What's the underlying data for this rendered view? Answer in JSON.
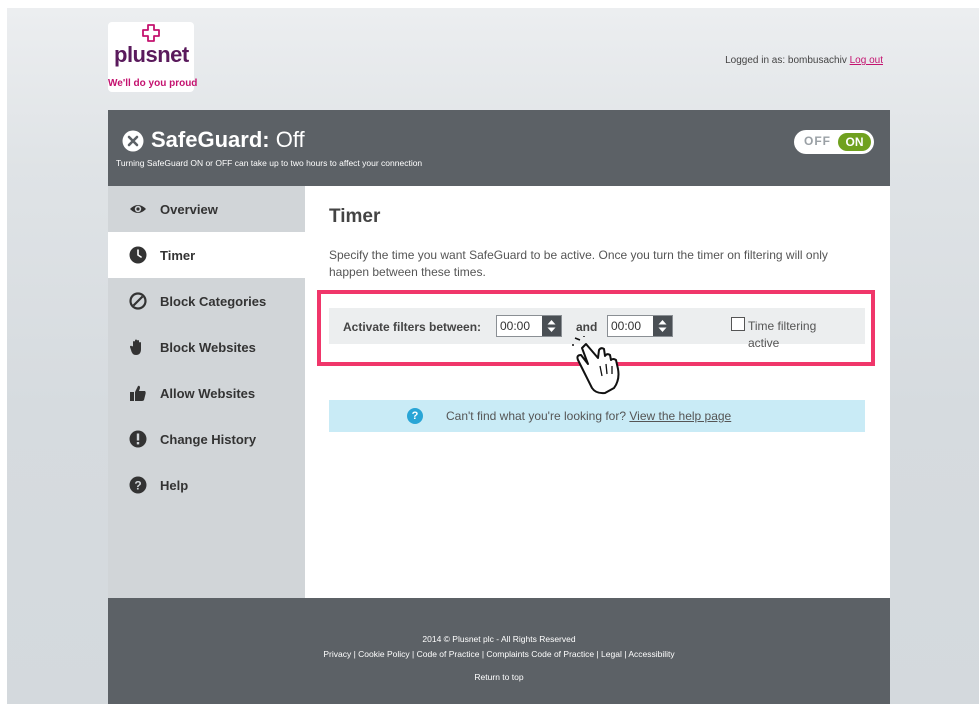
{
  "brand": {
    "name": "plusnet",
    "tagline": "We'll do you proud"
  },
  "header": {
    "logged_in_prefix": "Logged in as: bombusachiv",
    "logout_label": "Log out"
  },
  "banner": {
    "title_prefix": "SafeGuard:",
    "title_state": "Off",
    "subtitle": "Turning SafeGuard ON or OFF can take up to two hours to affect your connection",
    "toggle_off_label": "OFF",
    "toggle_on_label": "ON"
  },
  "sidebar": {
    "items": [
      {
        "label": "Overview",
        "icon": "eye-icon"
      },
      {
        "label": "Timer",
        "icon": "clock-icon",
        "active": true
      },
      {
        "label": "Block Categories",
        "icon": "prohibited-icon"
      },
      {
        "label": "Block Websites",
        "icon": "hand-stop-icon"
      },
      {
        "label": "Allow Websites",
        "icon": "thumbs-up-icon"
      },
      {
        "label": "Change History",
        "icon": "exclamation-icon"
      },
      {
        "label": "Help",
        "icon": "question-icon"
      }
    ]
  },
  "main": {
    "title": "Timer",
    "description": "Specify the time you want SafeGuard to be active. Once you turn the timer on filtering will only happen between these times.",
    "filter_label": "Activate filters between:",
    "start_time": "00:00",
    "and_label": "and",
    "end_time": "00:00",
    "checkbox_label": "Time filtering active",
    "checkbox_checked": false
  },
  "help_bar": {
    "icon_glyph": "?",
    "text": "Can't find what you're looking for?",
    "link": "View the help page"
  },
  "footer": {
    "copyright": "2014 © Plusnet plc - All Rights Reserved",
    "links": [
      "Privacy",
      "Cookie Policy",
      "Code of Practice",
      "Complaints Code of Practice",
      "Legal",
      "Accessibility"
    ],
    "return_to_top": "Return to top"
  },
  "colors": {
    "brand_purple": "#5a1a5c",
    "brand_pink": "#c4126f",
    "banner_gray": "#5c6166",
    "toggle_green": "#70a11f",
    "highlight_red": "#f0366a",
    "help_blue": "#c9ebf6"
  }
}
